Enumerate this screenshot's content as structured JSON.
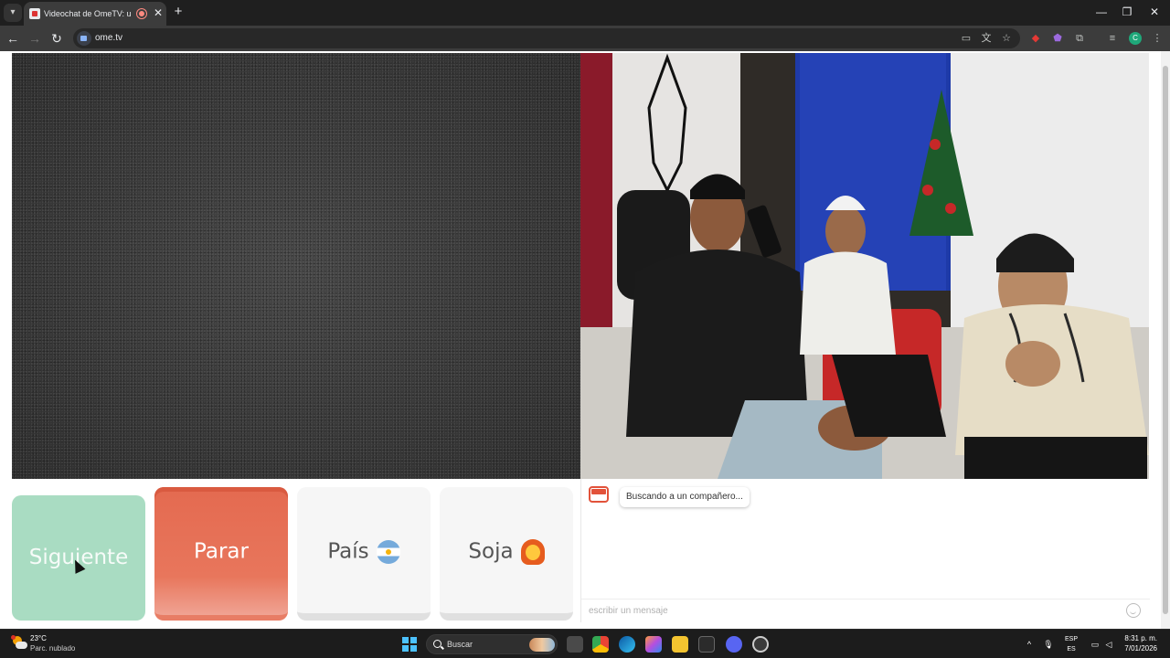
{
  "browser": {
    "tab_title": "Videochat de OmeTV: uno a uno",
    "tab_close": "✕",
    "new_tab": "+",
    "url": "ome.tv",
    "window_controls": {
      "minimize": "—",
      "maximize": "❐",
      "close": "✕"
    },
    "nav": {
      "back": "←",
      "forward": "→",
      "reload": "↻"
    },
    "toolbar_icons": [
      "cast-icon",
      "translate-icon",
      "bookmark-star-icon",
      "extension-red-icon",
      "extension-purple-icon",
      "extensions-puzzle-icon",
      "tab-media-icon"
    ],
    "profile_initial": "C",
    "menu": "⋮"
  },
  "controls": {
    "next_label": "Siguiente",
    "stop_label": "Parar",
    "country_label": "País",
    "gender_label": "Soja",
    "colors": {
      "next": "#a9dcc2",
      "stop": "#e46a50",
      "neutral": "#f6f6f6"
    }
  },
  "chat": {
    "status_message": "Buscando a un compañero...",
    "input_placeholder": "escribir un mensaje"
  },
  "taskbar": {
    "weather_temp": "23°C",
    "weather_desc": "Parc. nublado",
    "search_label": "Buscar",
    "lang_top": "ESP",
    "lang_bottom": "ES",
    "time": "8:31 p. m.",
    "date": "7/01/2026",
    "tray_chevron": "^"
  }
}
